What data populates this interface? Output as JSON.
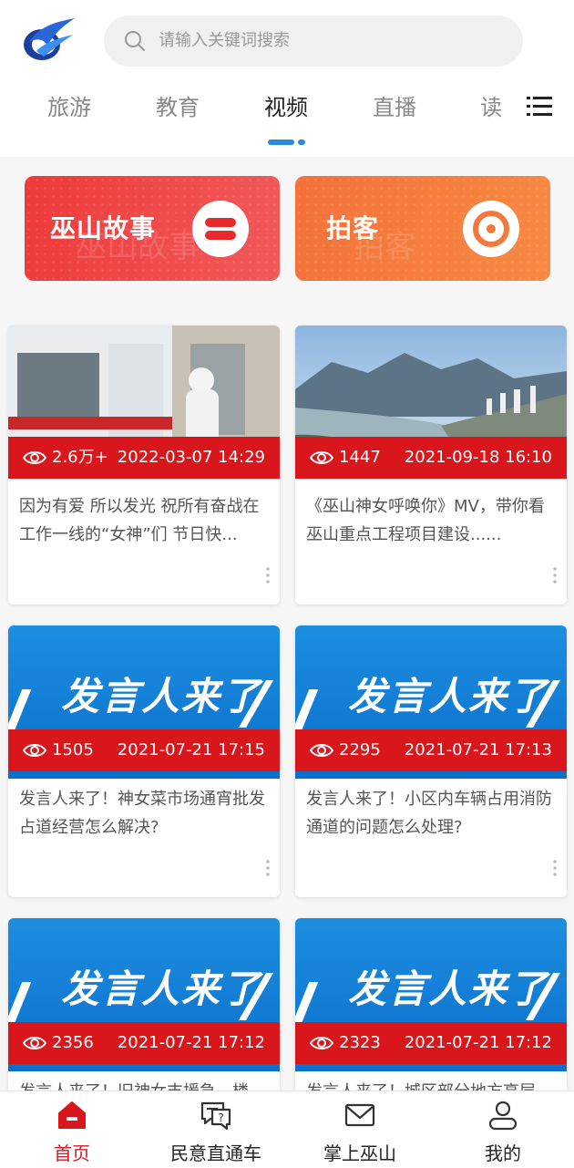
{
  "header": {
    "logo": "app-logo",
    "search_placeholder": "请输入关键词搜索"
  },
  "tabs": [
    {
      "label": "旅游",
      "active": false
    },
    {
      "label": "教育",
      "active": false
    },
    {
      "label": "视频",
      "active": true
    },
    {
      "label": "直播",
      "active": false
    },
    {
      "label": "读",
      "active": false
    }
  ],
  "banners": [
    {
      "label": "巫山故事",
      "ghost": "巫山故事",
      "icon": "stripes-circle-icon"
    },
    {
      "label": "拍客",
      "ghost": "拍客",
      "icon": "record-circle-icon"
    }
  ],
  "cards": [
    {
      "views": "2.6万+",
      "date": "2022-03-07 14:29",
      "title": "因为有爱 所以发光 祝所有奋战在工作一线的“女神”们 节日快...",
      "thumb": "ambulance-photo"
    },
    {
      "views": "1447",
      "date": "2021-09-18 16:10",
      "title": "《巫山神女呼唤你》MV，带你看巫山重点工程项目建设......",
      "thumb": "city-river-photo"
    },
    {
      "views": "1505",
      "date": "2021-07-21 17:15",
      "title": "发言人来了！神女菜市场通宵批发占道经营怎么解决?",
      "thumb": "spokesperson-banner",
      "thumb_text": "发言人来了"
    },
    {
      "views": "2295",
      "date": "2021-07-21 17:13",
      "title": "发言人来了！小区内车辆占用消防通道的问题怎么处理?",
      "thumb": "spokesperson-banner",
      "thumb_text": "发言人来了"
    },
    {
      "views": "2356",
      "date": "2021-07-21 17:12",
      "title": "发言人来了！旧神女支援急，楼",
      "thumb": "spokesperson-banner",
      "thumb_text": "发言人来了"
    },
    {
      "views": "2323",
      "date": "2021-07-21 17:12",
      "title": "发言人来了！城区部分地方高层",
      "thumb": "spokesperson-banner",
      "thumb_text": "发言人来了"
    }
  ],
  "bottom_nav": [
    {
      "label": "首页",
      "icon": "home-icon",
      "active": true
    },
    {
      "label": "民意直通车",
      "icon": "chat-question-icon",
      "active": false
    },
    {
      "label": "掌上巫山",
      "icon": "mail-icon",
      "active": false
    },
    {
      "label": "我的",
      "icon": "user-icon",
      "active": false
    }
  ],
  "colors": {
    "accent_red": "#d9161c",
    "tab_indicator": "#2b8be0",
    "banner_orange": "#f5793b"
  }
}
